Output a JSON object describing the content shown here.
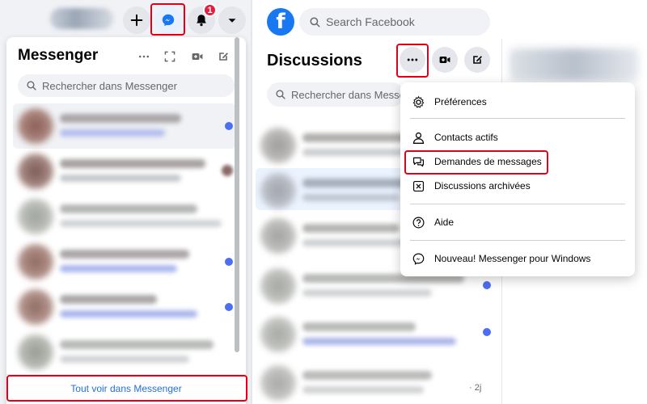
{
  "left_panel": {
    "notifications_count": "1",
    "title": "Messenger",
    "search_placeholder": "Rechercher dans Messenger",
    "see_all_label": "Tout voir dans Messenger"
  },
  "right_panel": {
    "logo_letter": "f",
    "search_placeholder": "Search Facebook",
    "title": "Discussions",
    "search_placeholder_short": "Rechercher dans Messen",
    "time_label": "· 2j"
  },
  "dropdown_menu": {
    "items": [
      {
        "label": "Préférences",
        "icon": "gear-icon"
      },
      {
        "label": "Contacts actifs",
        "icon": "person-icon"
      },
      {
        "label": "Demandes de messages",
        "icon": "chat-bubbles-icon"
      },
      {
        "label": "Discussions archivées",
        "icon": "archive-icon"
      },
      {
        "label": "Aide",
        "icon": "help-icon"
      },
      {
        "label": "Nouveau! Messenger pour Windows",
        "icon": "messenger-icon"
      }
    ]
  },
  "colors": {
    "accent_blue": "#1877f2",
    "highlight_red": "#e0001b",
    "unread_dot": "#4c6ef5",
    "badge_red": "#e41e3f"
  }
}
